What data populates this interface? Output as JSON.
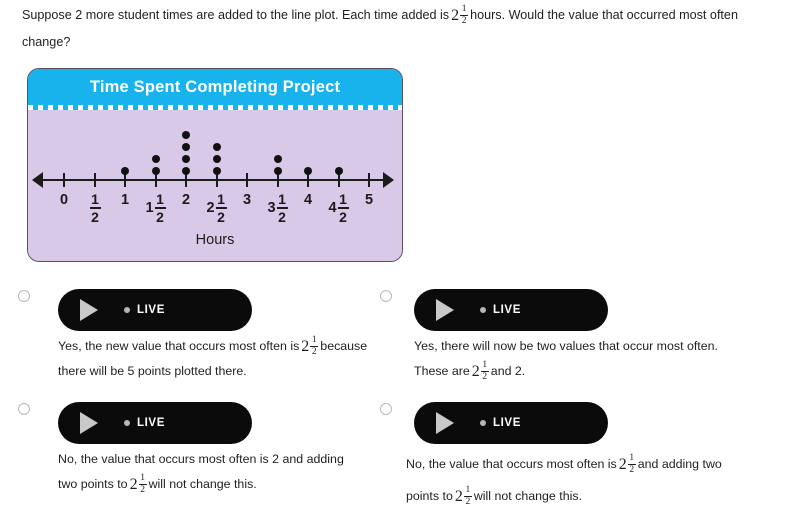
{
  "question": {
    "part1": "Suppose 2 more student times are added to the line plot. Each time added is",
    "value": {
      "whole": "2",
      "num": "1",
      "den": "2"
    },
    "part2": "hours. Would the value that occurred most often change?"
  },
  "plot": {
    "title": "Time Spent Completing Project",
    "caption": "Hours",
    "header_color": "#18b3ec",
    "body_color": "#d8c9e8",
    "border_color": "#5a4f63",
    "dot_color": "#111111"
  },
  "chart_data": {
    "type": "line_plot",
    "title": "Time Spent Completing Project",
    "xlabel": "Hours",
    "ylabel": "",
    "grid": false,
    "legend": "none",
    "xlim": [
      0,
      5
    ],
    "tick_step": 0.5,
    "categories": [
      "0",
      "1/2",
      "1",
      "1 1/2",
      "2",
      "2 1/2",
      "3",
      "3 1/2",
      "4",
      "4 1/2",
      "5"
    ],
    "tick_labels": [
      {
        "whole": "0",
        "num": "",
        "den": ""
      },
      {
        "whole": "",
        "num": "1",
        "den": "2"
      },
      {
        "whole": "1",
        "num": "",
        "den": ""
      },
      {
        "whole": "1",
        "num": "1",
        "den": "2"
      },
      {
        "whole": "2",
        "num": "",
        "den": ""
      },
      {
        "whole": "2",
        "num": "1",
        "den": "2"
      },
      {
        "whole": "3",
        "num": "",
        "den": ""
      },
      {
        "whole": "3",
        "num": "1",
        "den": "2"
      },
      {
        "whole": "4",
        "num": "",
        "den": ""
      },
      {
        "whole": "4",
        "num": "1",
        "den": "2"
      },
      {
        "whole": "5",
        "num": "",
        "den": ""
      }
    ],
    "x": [
      0,
      0.5,
      1,
      1.5,
      2,
      2.5,
      3,
      3.5,
      4,
      4.5,
      5
    ],
    "values": [
      0,
      0,
      1,
      2,
      4,
      3,
      0,
      2,
      1,
      1,
      0
    ],
    "total_points": 14,
    "mode": "2"
  },
  "options": [
    {
      "id": "option-a",
      "player_label": "LIVE",
      "icon": "play-icon",
      "text_before": "Yes, the new value that occurs most often is",
      "value": {
        "whole": "2",
        "num": "1",
        "den": "2"
      },
      "text_after": "because there will be 5 points plotted there."
    },
    {
      "id": "option-b",
      "player_label": "LIVE",
      "icon": "play-icon",
      "text_before": "Yes, there will now be two values that occur most often. These are",
      "value": {
        "whole": "2",
        "num": "1",
        "den": "2"
      },
      "text_after": "and 2."
    },
    {
      "id": "option-c",
      "player_label": "LIVE",
      "icon": "play-icon",
      "text_before": "No, the value that occurs most often is 2 and adding two points to",
      "value": {
        "whole": "2",
        "num": "1",
        "den": "2"
      },
      "text_after": "will not change this."
    },
    {
      "id": "option-d",
      "player_label": "LIVE",
      "icon": "play-icon",
      "text_before": "No, the value that occurs most often is",
      "value": {
        "whole": "2",
        "num": "1",
        "den": "2"
      },
      "text_mid": "and adding two points to",
      "value2": {
        "whole": "2",
        "num": "1",
        "den": "2"
      },
      "text_after": "will not change this."
    }
  ]
}
